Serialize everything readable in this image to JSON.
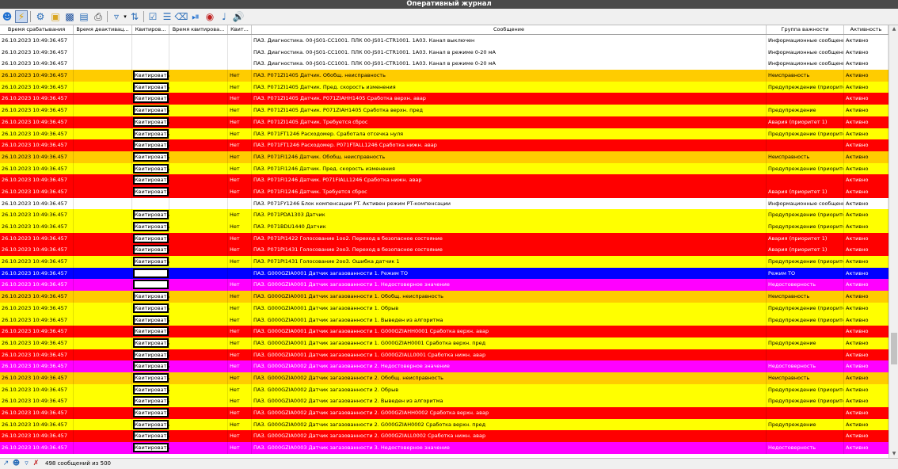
{
  "window": {
    "title": "Оперативный журнал"
  },
  "toolbar": {
    "icons": [
      "user-icon",
      "lightning-icon",
      "gear-icon",
      "folder-icon",
      "save-icon",
      "export-icon",
      "print-icon",
      "filter-icon",
      "sort-icon",
      "checkbox-icon",
      "checklist-icon",
      "eraser-icon",
      "pause-icon",
      "record-icon",
      "sound-icon",
      "volume-icon"
    ]
  },
  "table": {
    "columns": [
      "Время срабатывания",
      "Время деактивац...",
      "Квитиров...",
      "Время квитирова...",
      "Квит...",
      "Сообщение",
      "Группа важности",
      "Активность"
    ],
    "ack_label": "Квитировать",
    "row_colors": {
      "white": {
        "bg": "#ffffff",
        "fg": "#000000"
      },
      "yellow": {
        "bg": "#ffff00",
        "fg": "#000000"
      },
      "orange": {
        "bg": "#ffcc00",
        "fg": "#000000"
      },
      "red": {
        "bg": "#ff0000",
        "fg": "#ffffff"
      },
      "blue": {
        "bg": "#0000ff",
        "fg": "#ffffff"
      },
      "magenta": {
        "bg": "#ff00ff",
        "fg": "#ffffff"
      }
    },
    "rows": [
      {
        "time": "26.10.2023 10:49:36.457",
        "ack": "none",
        "kvit": "",
        "msg": "ПАЗ. Диагностика. 00-JS01-CC1001. ПЛК 00-JS01-CTR1001. 1A03. Канал выключен",
        "group": "Информационные сообщения",
        "active": "Активно",
        "color": "white"
      },
      {
        "time": "26.10.2023 10:49:36.457",
        "ack": "none",
        "kvit": "",
        "msg": "ПАЗ. Диагностика. 00-JS01-CC1001. ПЛК 00-JS01-CTR1001. 1A03. Канал в режиме 0-20 мА",
        "group": "Информационные сообщения",
        "active": "Активно",
        "color": "white"
      },
      {
        "time": "26.10.2023 10:49:36.457",
        "ack": "none",
        "kvit": "",
        "msg": "ПАЗ. Диагностика. 00-JS01-CC1001. ПЛК 00-JS01-CTR1001. 1A03. Канал в режиме 0-20 мА",
        "group": "Информационные сообщения",
        "active": "Активно",
        "color": "white"
      },
      {
        "time": "26.10.2023 10:49:36.457",
        "ack": "button",
        "kvit": "Нет",
        "msg": "ПАЗ. P071ZI1405 Датчик. Обобщ. неисправность",
        "group": "Неисправность",
        "active": "Активно",
        "color": "orange"
      },
      {
        "time": "26.10.2023 10:49:36.457",
        "ack": "button",
        "kvit": "Нет",
        "msg": "ПАЗ. P071ZI1405 Датчик. Пред. скорость изменения",
        "group": "Предупреждение (приоритет 2)",
        "active": "Активно",
        "color": "yellow"
      },
      {
        "time": "26.10.2023 10:49:36.457",
        "ack": "button",
        "kvit": "Нет",
        "msg": "ПАЗ. P071ZI1405 Датчик. P071ZIAHH1405 Сработка верхн. авар",
        "group": "",
        "active": "Активно",
        "color": "red"
      },
      {
        "time": "26.10.2023 10:49:36.457",
        "ack": "button",
        "kvit": "Нет",
        "msg": "ПАЗ. P071ZI1405 Датчик. P071ZIAH1405 Сработка верхн. пред",
        "group": "Предупреждение",
        "active": "Активно",
        "color": "yellow"
      },
      {
        "time": "26.10.2023 10:49:36.457",
        "ack": "button",
        "kvit": "Нет",
        "msg": "ПАЗ. P071ZI1405 Датчик. Требуется сброс",
        "group": "Авария (приоритет 1)",
        "active": "Активно",
        "color": "red"
      },
      {
        "time": "26.10.2023 10:49:36.457",
        "ack": "button",
        "kvit": "Нет",
        "msg": "ПАЗ. P071FT1246 Расходомер. Сработала отсечка нуля",
        "group": "Предупреждение (приоритет 2)",
        "active": "Активно",
        "color": "yellow"
      },
      {
        "time": "26.10.2023 10:49:36.457",
        "ack": "button",
        "kvit": "Нет",
        "msg": "ПАЗ. P071FT1246 Расходомер. P071FTALL1246 Сработка нижн. авар",
        "group": "",
        "active": "Активно",
        "color": "red"
      },
      {
        "time": "26.10.2023 10:49:36.457",
        "ack": "button",
        "kvit": "Нет",
        "msg": "ПАЗ. P071FI1246 Датчик. Обобщ. неисправность",
        "group": "Неисправность",
        "active": "Активно",
        "color": "orange"
      },
      {
        "time": "26.10.2023 10:49:36.457",
        "ack": "button",
        "kvit": "Нет",
        "msg": "ПАЗ. P071FI1246 Датчик. Пред. скорость изменения",
        "group": "Предупреждение (приоритет 2)",
        "active": "Активно",
        "color": "yellow"
      },
      {
        "time": "26.10.2023 10:49:36.457",
        "ack": "button",
        "kvit": "Нет",
        "msg": "ПАЗ. P071FI1246 Датчик. P071FIALL1246 Сработка нижн. авар",
        "group": "",
        "active": "Активно",
        "color": "red"
      },
      {
        "time": "26.10.2023 10:49:36.457",
        "ack": "button",
        "kvit": "Нет",
        "msg": "ПАЗ. P071FI1246 Датчик. Требуется сброс",
        "group": "Авария (приоритет 1)",
        "active": "Активно",
        "color": "red"
      },
      {
        "time": "26.10.2023 10:49:36.457",
        "ack": "none",
        "kvit": "",
        "msg": "ПАЗ. P071FY1246 Блок компенсации PT. Активен режим PT-компенсации",
        "group": "Информационные сообщения",
        "active": "Активно",
        "color": "white"
      },
      {
        "time": "26.10.2023 10:49:36.457",
        "ack": "button",
        "kvit": "Нет",
        "msg": "ПАЗ. P071PDA1303 Датчик",
        "group": "Предупреждение (приоритет 2)",
        "active": "Активно",
        "color": "yellow"
      },
      {
        "time": "26.10.2023 10:49:36.457",
        "ack": "button",
        "kvit": "Нет",
        "msg": "ПАЗ. P071BDU1440 Датчик",
        "group": "Предупреждение (приоритет 2)",
        "active": "Активно",
        "color": "yellow"
      },
      {
        "time": "26.10.2023 10:49:36.457",
        "ack": "button",
        "kvit": "Нет",
        "msg": "ПАЗ. P071PI1422 Голосование 1оо2. Переход в безопасное состояние",
        "group": "Авария (приоритет 1)",
        "active": "Активно",
        "color": "red"
      },
      {
        "time": "26.10.2023 10:49:36.457",
        "ack": "button",
        "kvit": "Нет",
        "msg": "ПАЗ. P071PI1431 Голосование 2оо3. Переход в безопасное состояние",
        "group": "Авария (приоритет 1)",
        "active": "Активно",
        "color": "red"
      },
      {
        "time": "26.10.2023 10:49:36.457",
        "ack": "button",
        "kvit": "Нет",
        "msg": "ПАЗ. P071PI1431 Голосование 2оо3. Ошибка датчик 1",
        "group": "Предупреждение (приоритет 2)",
        "active": "Активно",
        "color": "yellow"
      },
      {
        "time": "26.10.2023 10:49:36.457",
        "ack": "blank",
        "kvit": "",
        "msg": "ПАЗ. G000GZIA0001 Датчик загазованности 1. Режим ТО",
        "group": "Режим ТО",
        "active": "Активно",
        "color": "blue"
      },
      {
        "time": "26.10.2023 10:49:36.457",
        "ack": "blank",
        "kvit": "Нет",
        "msg": "ПАЗ. G000GZIA0001 Датчик загазованности 1. Недостоверное значение",
        "group": "Недостоверность",
        "active": "Активно",
        "color": "magenta"
      },
      {
        "time": "26.10.2023 10:49:36.457",
        "ack": "button",
        "kvit": "Нет",
        "msg": "ПАЗ. G000GZIA0001 Датчик загазованности 1. Обобщ. неисправность",
        "group": "Неисправность",
        "active": "Активно",
        "color": "orange"
      },
      {
        "time": "26.10.2023 10:49:36.457",
        "ack": "button",
        "kvit": "Нет",
        "msg": "ПАЗ. G000GZIA0001 Датчик загазованности 1. Обрыв",
        "group": "Предупреждение (приоритет 2)",
        "active": "Активно",
        "color": "yellow"
      },
      {
        "time": "26.10.2023 10:49:36.457",
        "ack": "button",
        "kvit": "Нет",
        "msg": "ПАЗ. G000GZIA0001 Датчик загазованности 1. Выведен из алгоритма",
        "group": "Предупреждение (приоритет 2)",
        "active": "Активно",
        "color": "yellow"
      },
      {
        "time": "26.10.2023 10:49:36.457",
        "ack": "button",
        "kvit": "Нет",
        "msg": "ПАЗ. G000GZIA0001 Датчик загазованности 1. G000GZIAHH0001 Сработка верхн. авар",
        "group": "",
        "active": "Активно",
        "color": "red"
      },
      {
        "time": "26.10.2023 10:49:36.457",
        "ack": "button",
        "kvit": "Нет",
        "msg": "ПАЗ. G000GZIA0001 Датчик загазованности 1. G000GZIAH0001 Сработка верхн. пред",
        "group": "Предупреждение",
        "active": "Активно",
        "color": "yellow"
      },
      {
        "time": "26.10.2023 10:49:36.457",
        "ack": "button",
        "kvit": "Нет",
        "msg": "ПАЗ. G000GZIA0001 Датчик загазованности 1. G000GZIALL0001 Сработка нижн. авар",
        "group": "",
        "active": "Активно",
        "color": "red"
      },
      {
        "time": "26.10.2023 10:49:36.457",
        "ack": "button",
        "kvit": "Нет",
        "msg": "ПАЗ. G000GZIA0002 Датчик загазованности 2. Недостоверное значение",
        "group": "Недостоверность",
        "active": "Активно",
        "color": "magenta"
      },
      {
        "time": "26.10.2023 10:49:36.457",
        "ack": "button",
        "kvit": "Нет",
        "msg": "ПАЗ. G000GZIA0002 Датчик загазованности 2. Обобщ. неисправность",
        "group": "Неисправность",
        "active": "Активно",
        "color": "orange"
      },
      {
        "time": "26.10.2023 10:49:36.457",
        "ack": "button",
        "kvit": "Нет",
        "msg": "ПАЗ. G000GZIA0002 Датчик загазованности 2. Обрыв",
        "group": "Предупреждение (приоритет 2)",
        "active": "Активно",
        "color": "yellow"
      },
      {
        "time": "26.10.2023 10:49:36.457",
        "ack": "button",
        "kvit": "Нет",
        "msg": "ПАЗ. G000GZIA0002 Датчик загазованности 2. Выведен из алгоритма",
        "group": "Предупреждение (приоритет 2)",
        "active": "Активно",
        "color": "yellow"
      },
      {
        "time": "26.10.2023 10:49:36.457",
        "ack": "button",
        "kvit": "Нет",
        "msg": "ПАЗ. G000GZIA0002 Датчик загазованности 2. G000GZIAHH0002 Сработка верхн. авар",
        "group": "",
        "active": "Активно",
        "color": "red"
      },
      {
        "time": "26.10.2023 10:49:36.457",
        "ack": "button",
        "kvit": "Нет",
        "msg": "ПАЗ. G000GZIA0002 Датчик загазованности 2. G000GZIAH0002 Сработка верхн. пред",
        "group": "Предупреждение",
        "active": "Активно",
        "color": "yellow"
      },
      {
        "time": "26.10.2023 10:49:36.457",
        "ack": "button",
        "kvit": "Нет",
        "msg": "ПАЗ. G000GZIA0002 Датчик загазованности 2. G000GZIALL0002 Сработка нижн. авар",
        "group": "",
        "active": "Активно",
        "color": "red"
      },
      {
        "time": "26.10.2023 10:49:36.457",
        "ack": "button",
        "kvit": "Нет",
        "msg": "ПАЗ. G000GZIA0003 Датчик загазованности 3. Недостоверное значение",
        "group": "Недостоверность",
        "active": "Активно",
        "color": "magenta"
      }
    ]
  },
  "statusbar": {
    "icons": [
      "connect-icon",
      "user-search-icon",
      "filter-small-icon",
      "clear-icon"
    ],
    "text": "498 сообщений из 500"
  }
}
